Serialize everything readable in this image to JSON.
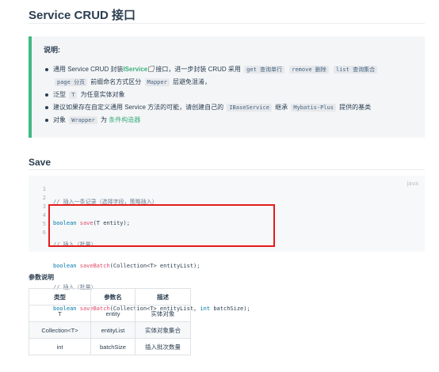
{
  "page": {
    "title": "Service CRUD 接口"
  },
  "tip": {
    "heading": "说明:",
    "bullet1": {
      "t1": "通用 Service CRUD 封装",
      "link": "IService",
      "t2": " 接口，进一步封装 CRUD 采用 ",
      "code1": "get 查询单行",
      "code2": "remove 删除",
      "code3": "list 查询集合",
      "code4": "page 分页",
      "t3": " 前缀命名方式区分 ",
      "code5": "Mapper",
      "t4": " 层避免混淆，"
    },
    "bullet2": {
      "t1": "泛型 ",
      "code": "T",
      "t2": " 为任意实体对象"
    },
    "bullet3": {
      "t1": "建议如果存在自定义通用 Service 方法的可能，请创建自己的 ",
      "code1": "IBaseService",
      "t2": " 继承 ",
      "code2": "Mybatis-Plus",
      "t3": " 提供的基类"
    },
    "bullet4": {
      "t1": "对象 ",
      "code": "Wrapper",
      "t2": " 为 ",
      "link": "条件构造器"
    }
  },
  "save_section": {
    "title": "Save"
  },
  "code": {
    "lang": "java",
    "line_numbers": [
      "1",
      "2",
      "3",
      "4",
      "5",
      "6"
    ],
    "l1_comment": "// 插入一条记录（选择字段，策略插入）",
    "l2_kw": "boolean",
    "l2_fn": "save",
    "l2_rest": "(T entity);",
    "l3_comment": "// 插入（批量）",
    "l4_kw": "boolean",
    "l4_fn": "saveBatch",
    "l4_rest": "(Collection<T> entityList);",
    "l5_comment": "// 插入（批量）",
    "l6_kw": "boolean",
    "l6_fn": "saveBatch",
    "l6_rest1": "(Collection<T> entityList, ",
    "l6_kw2": "int",
    "l6_rest2": " batchSize);"
  },
  "params": {
    "title": "参数说明",
    "headers": [
      "类型",
      "参数名",
      "描述"
    ],
    "rows": [
      [
        "T",
        "entity",
        "实体对象"
      ],
      [
        "Collection<T>",
        "entityList",
        "实体对象集合"
      ],
      [
        "int",
        "batchSize",
        "插入批次数量"
      ]
    ]
  },
  "colors": {
    "accent": "#42b983",
    "link": "#3eaf7c",
    "highlight_border": "#e41b1b"
  }
}
